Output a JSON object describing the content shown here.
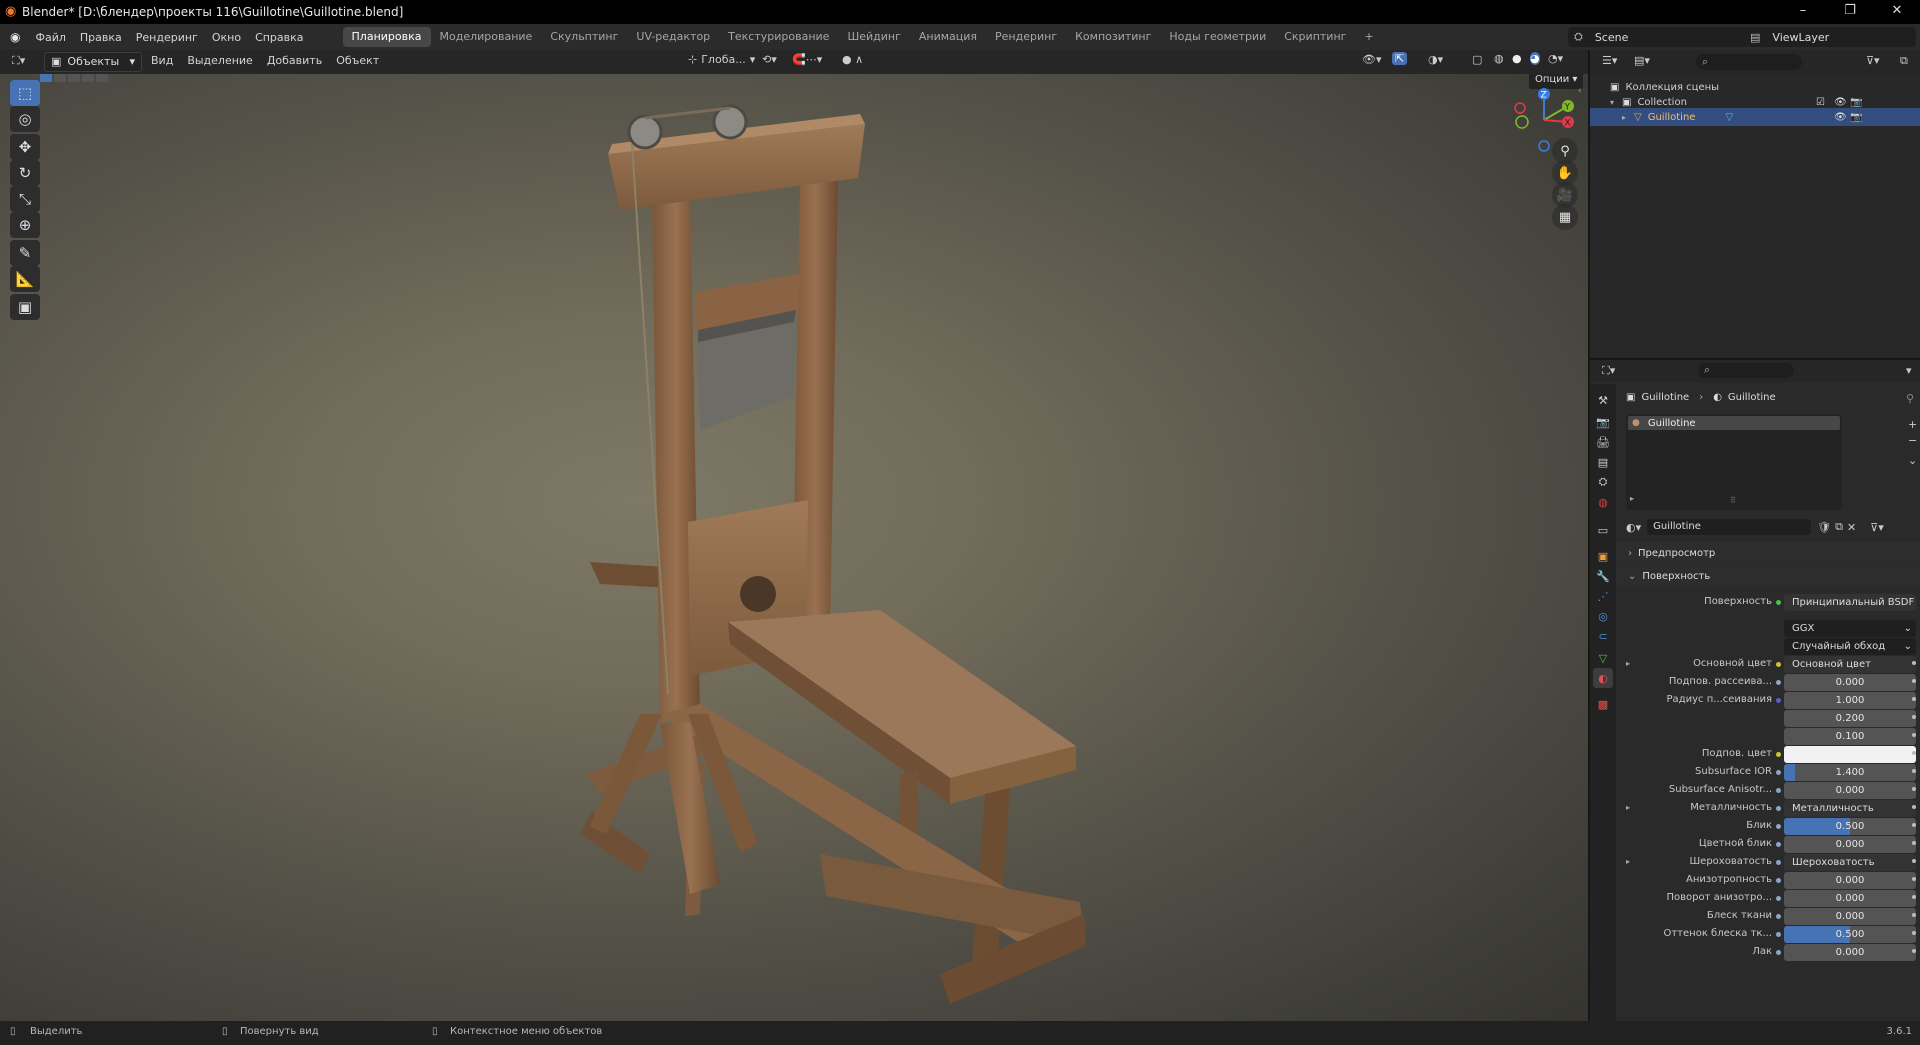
{
  "window": {
    "title": "Blender* [D:\\блендер\\проекты 116\\Guillotine\\Guillotine.blend]",
    "min": "–",
    "max": "❐",
    "close": "✕"
  },
  "menubar": {
    "menus": [
      "Файл",
      "Правка",
      "Рендеринг",
      "Окно",
      "Справка"
    ],
    "workspaces": [
      "Планировка",
      "Моделирование",
      "Скульптинг",
      "UV-редактор",
      "Текстурирование",
      "Шейдинг",
      "Анимация",
      "Рендеринг",
      "Композитинг",
      "Ноды геометрии",
      "Скриптинг"
    ],
    "active_workspace": "Планировка",
    "add": "+",
    "scene": "Scene",
    "view_layer": "ViewLayer"
  },
  "viewport_header": {
    "mode": "Объекты",
    "menus": [
      "Вид",
      "Выделение",
      "Добавить",
      "Объект"
    ],
    "orientation": "Глоба...",
    "options": "Опции"
  },
  "tools": [
    {
      "name": "select-box-tool",
      "icon": "⬚"
    },
    {
      "name": "cursor-tool",
      "icon": "◎"
    },
    {
      "name": "move-tool",
      "icon": "✥"
    },
    {
      "name": "rotate-tool",
      "icon": "↻"
    },
    {
      "name": "scale-tool",
      "icon": "⤡"
    },
    {
      "name": "transform-tool",
      "icon": "⊕"
    },
    {
      "name": "annotate-tool",
      "icon": "✎"
    },
    {
      "name": "measure-tool",
      "icon": "📐"
    },
    {
      "name": "add-cube-tool",
      "icon": "▣"
    }
  ],
  "gizmo": {
    "x": "X",
    "y": "Y",
    "z": "Z"
  },
  "nav_buttons": [
    {
      "name": "zoom-icon",
      "icon": "⚲"
    },
    {
      "name": "hand-pan-icon",
      "icon": "✋"
    },
    {
      "name": "camera-icon",
      "icon": "🎥"
    },
    {
      "name": "grid-ortho-icon",
      "icon": "▦"
    }
  ],
  "outliner": {
    "search_placeholder": "",
    "rows": [
      {
        "label": "Коллекция сцены",
        "indent": 0,
        "selected": false
      },
      {
        "label": "Collection",
        "indent": 1,
        "selected": false
      },
      {
        "label": "Guillotine",
        "indent": 2,
        "selected": true
      }
    ]
  },
  "properties": {
    "breadcrumb": {
      "object": "Guillotine",
      "material": "Guillotine"
    },
    "slot": "Guillotine",
    "material_name": "Guillotine",
    "panels": {
      "preview": "Предпросмотр",
      "surface": "Поверхность"
    },
    "surface_label": "Поверхность",
    "surface_value": "Принципиальный BSDF",
    "distribution": "GGX",
    "subsurface_method": "Случайный обход",
    "rows": [
      {
        "label": "Основной цвет",
        "value": "Основной цвет",
        "kind": "link",
        "dot": "#c7c729",
        "expand": true
      },
      {
        "label": "Подпов. рассеива...",
        "value": "0.000",
        "kind": "num",
        "fill": 0,
        "dot": "#8fa4c9"
      },
      {
        "label": "Радиус п...сеивания",
        "value": "1.000",
        "kind": "num",
        "fill": 0,
        "dot": "#5c5ccc"
      },
      {
        "label": "",
        "value": "0.200",
        "kind": "num",
        "fill": 0,
        "dot": ""
      },
      {
        "label": "",
        "value": "0.100",
        "kind": "num",
        "fill": 0,
        "dot": ""
      },
      {
        "label": "Подпов. цвет",
        "value": "",
        "kind": "color",
        "dot": "#c7c729"
      },
      {
        "label": "Subsurface IOR",
        "value": "1.400",
        "kind": "num",
        "fill": 0.08,
        "dot": "#8fa4c9"
      },
      {
        "label": "Subsurface Anisotr...",
        "value": "0.000",
        "kind": "num",
        "fill": 0,
        "dot": "#8fa4c9"
      },
      {
        "label": "Металличность",
        "value": "Металличность",
        "kind": "link",
        "dot": "#8fa4c9",
        "expand": true
      },
      {
        "label": "Блик",
        "value": "0.500",
        "kind": "num",
        "fill": 0.5,
        "dot": "#8fa4c9"
      },
      {
        "label": "Цветной блик",
        "value": "0.000",
        "kind": "num",
        "fill": 0,
        "dot": "#8fa4c9"
      },
      {
        "label": "Шероховатость",
        "value": "Шероховатость",
        "kind": "link",
        "dot": "#8fa4c9",
        "expand": true
      },
      {
        "label": "Анизотропность",
        "value": "0.000",
        "kind": "num",
        "fill": 0,
        "dot": "#8fa4c9"
      },
      {
        "label": "Поворот анизотро...",
        "value": "0.000",
        "kind": "num",
        "fill": 0,
        "dot": "#8fa4c9"
      },
      {
        "label": "Блеск ткани",
        "value": "0.000",
        "kind": "num",
        "fill": 0,
        "dot": "#8fa4c9"
      },
      {
        "label": "Оттенок блеска тк...",
        "value": "0.500",
        "kind": "num",
        "fill": 0.5,
        "dot": "#8fa4c9"
      },
      {
        "label": "Лак",
        "value": "0.000",
        "kind": "num",
        "fill": 0,
        "dot": "#8fa4c9"
      }
    ]
  },
  "statusbar": {
    "select": "Выделить",
    "rotate_view": "Повернуть вид",
    "context_menu": "Контекстное меню объектов",
    "version": "3.6.1"
  }
}
